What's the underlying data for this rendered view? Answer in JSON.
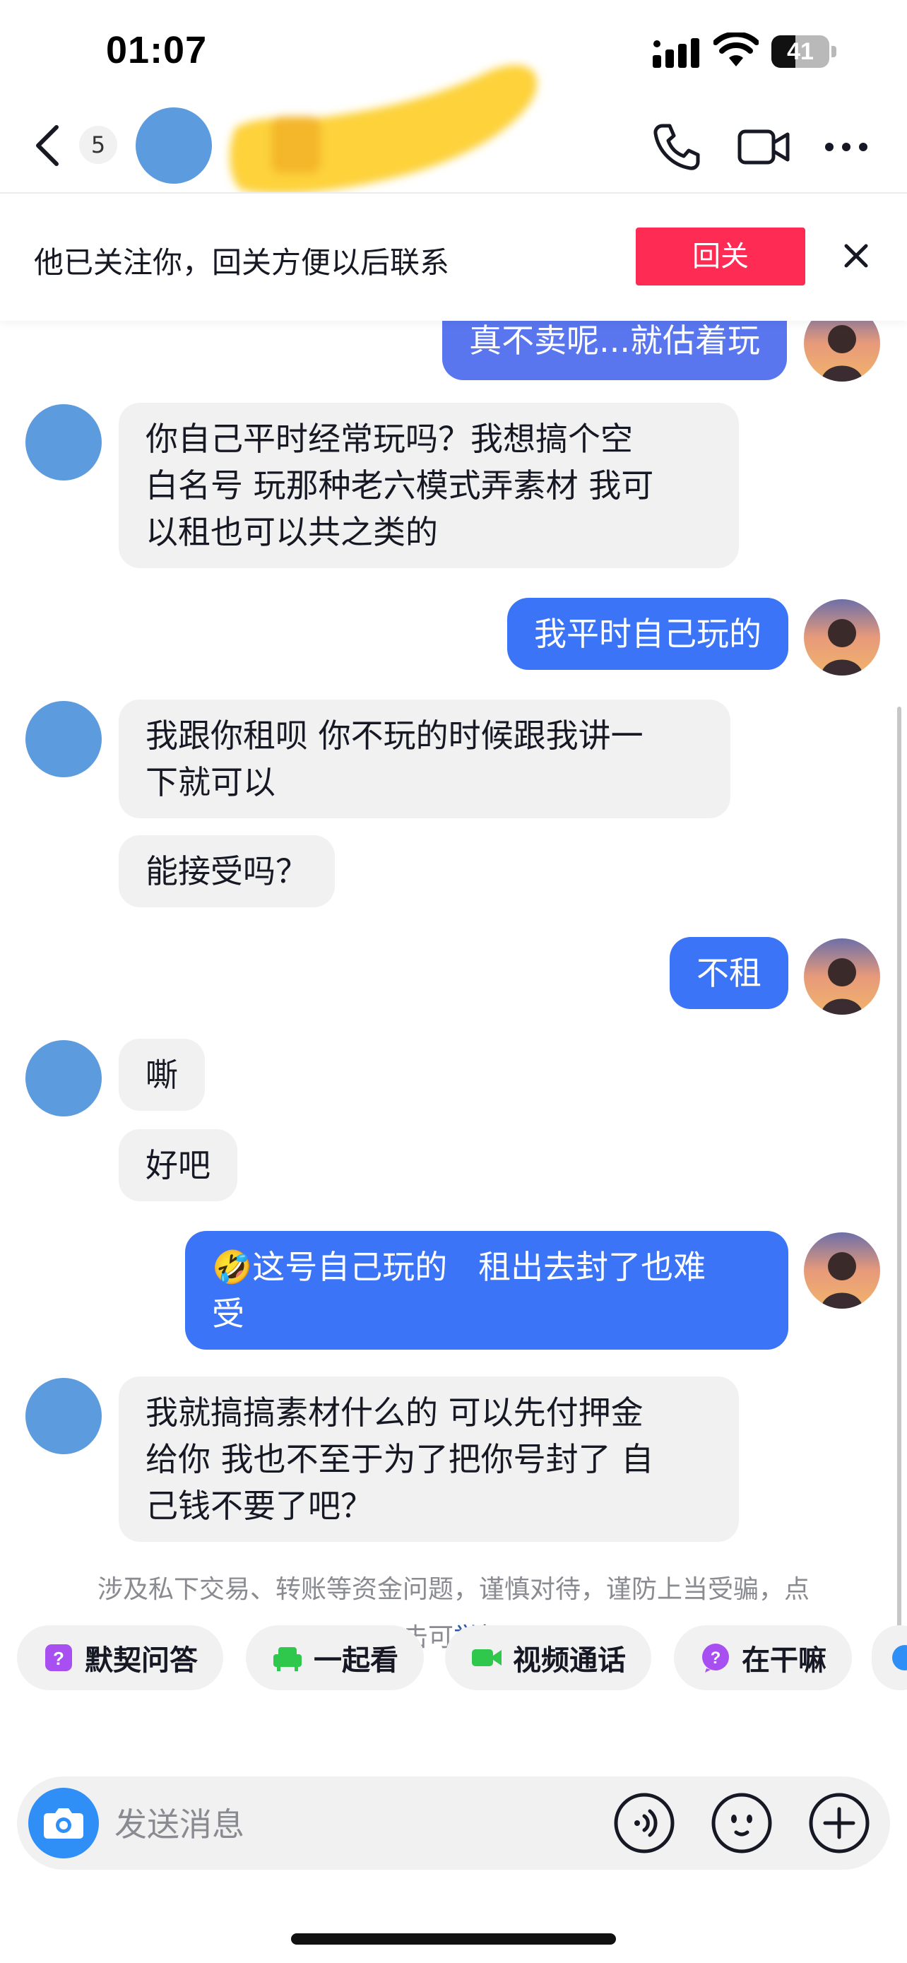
{
  "status_bar": {
    "time": "01:07",
    "battery": "41",
    "battery_level": 0.41
  },
  "header": {
    "unread_count": "5",
    "icons": [
      "back-icon",
      "phone-icon",
      "video-camera-icon",
      "more-icon"
    ]
  },
  "follow_banner": {
    "text": "他已关注你，回关方便以后联系",
    "button_label": "回关",
    "accent": "#fe2c55"
  },
  "messages": [
    {
      "side": "me",
      "text": "真不卖呢...就估着玩"
    },
    {
      "side": "them",
      "text": "你自己平时经常玩吗？我想搞个空\n白名号 玩那种老六模式弄素材 我可\n以租也可以共之类的"
    },
    {
      "side": "me",
      "text": "我平时自己玩的"
    },
    {
      "side": "them",
      "text": "我跟你租呗 你不玩的时候跟我讲一\n下就可以"
    },
    {
      "side": "them",
      "text": "能接受吗？"
    },
    {
      "side": "me",
      "text": "不租"
    },
    {
      "side": "them",
      "text": "嘶"
    },
    {
      "side": "them",
      "text": "好吧"
    },
    {
      "side": "me",
      "emoji": "🤣",
      "text": "这号自己玩的   租出去封了也难\n受"
    },
    {
      "side": "them",
      "text": "我就搞搞素材什么的 可以先付押金\n给你 我也不至于为了把你号封了 自\n己钱不要了吧？"
    }
  ],
  "warning": {
    "text": "涉及私下交易、转账等资金问题，谨慎对待，谨防上当受骗，点\n击可",
    "link": "举报"
  },
  "quick_replies": [
    {
      "label": "默契问答",
      "icon": "question-card-icon",
      "color": "#a74ff0"
    },
    {
      "label": "一起看",
      "icon": "sofa-icon",
      "color": "#2fc84d"
    },
    {
      "label": "视频通话",
      "icon": "video-camera-icon",
      "color": "#2fc84d"
    },
    {
      "label": "在干嘛",
      "icon": "question-bubble-icon",
      "color": "#a74ff0"
    }
  ],
  "input": {
    "placeholder": "发送消息"
  },
  "colors": {
    "outgoing_bubble": "#3b74f6",
    "incoming_bubble": "#f1f1f2",
    "avatar": "#5b9bde"
  }
}
